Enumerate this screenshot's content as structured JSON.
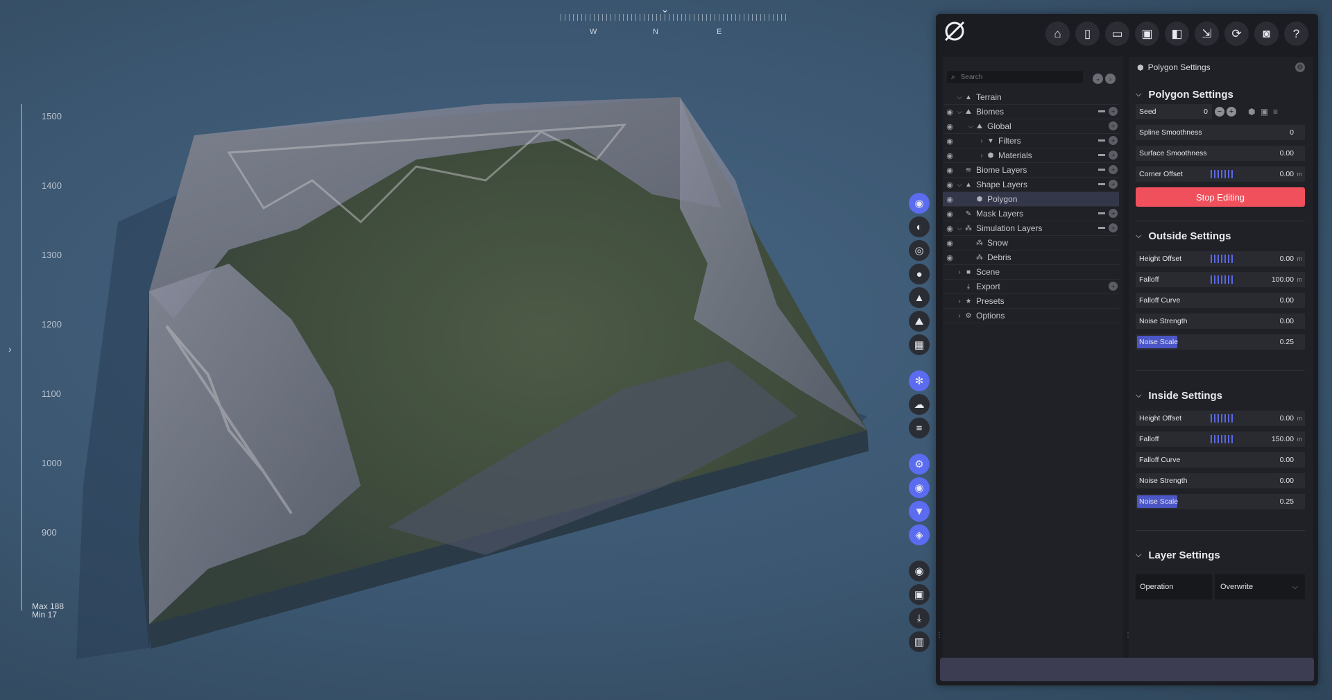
{
  "ruler": {
    "ticks": [
      "1500",
      "1400",
      "1300",
      "1200",
      "1100",
      "1000",
      "900"
    ],
    "max_label": "Max 188",
    "min_label": "Min 17"
  },
  "compass": {
    "w": "W",
    "n": "N",
    "e": "E"
  },
  "toolstrip": {
    "group1": [
      "terrain-tool-icon",
      "globe-icon",
      "target-icon",
      "water-drop-icon",
      "mountain-icon",
      "height-icon",
      "grid-icon"
    ],
    "group2": [
      "snow-icon",
      "cloud-icon",
      "layers-lines-icon"
    ],
    "group3": [
      "shuffle-icon",
      "eye-icon",
      "filter-icon",
      "stack-icon"
    ],
    "group4": [
      "record-icon",
      "image-icon",
      "download-icon",
      "chart-icon"
    ]
  },
  "topbar": {
    "icons": [
      "home-icon",
      "new-file-icon",
      "open-folder-icon",
      "save-icon",
      "save-as-icon",
      "export-icon",
      "refresh-icon",
      "camera-icon",
      "help-icon"
    ]
  },
  "tree": {
    "search_placeholder": "Search",
    "rows": [
      {
        "label": "Terrain",
        "indent": 0,
        "eye": false,
        "chev": "⌵",
        "icon": "▲",
        "btns": 0,
        "sel": false
      },
      {
        "label": "Biomes",
        "indent": 0,
        "eye": true,
        "chev": "⌵",
        "icon": "⛰",
        "btns": 2,
        "sel": false
      },
      {
        "label": "Global",
        "indent": 1,
        "eye": true,
        "chev": "⌵",
        "icon": "⛰",
        "btns": 1,
        "sel": false
      },
      {
        "label": "Filters",
        "indent": 2,
        "eye": true,
        "chev": "›",
        "icon": "▼",
        "btns": 2,
        "sel": false
      },
      {
        "label": "Materials",
        "indent": 2,
        "eye": true,
        "chev": "›",
        "icon": "⬢",
        "btns": 2,
        "sel": false
      },
      {
        "label": "Biome Layers",
        "indent": 0,
        "eye": true,
        "chev": "",
        "icon": "≋",
        "btns": 2,
        "sel": false
      },
      {
        "label": "Shape Layers",
        "indent": 0,
        "eye": true,
        "chev": "⌵",
        "icon": "▲",
        "btns": 2,
        "sel": false
      },
      {
        "label": "Polygon",
        "indent": 1,
        "eye": true,
        "chev": "",
        "icon": "⬢",
        "btns": 0,
        "sel": true
      },
      {
        "label": "Mask Layers",
        "indent": 0,
        "eye": true,
        "chev": "",
        "icon": "✎",
        "btns": 2,
        "sel": false
      },
      {
        "label": "Simulation Layers",
        "indent": 0,
        "eye": true,
        "chev": "⌵",
        "icon": "⁂",
        "btns": 2,
        "sel": false
      },
      {
        "label": "Snow",
        "indent": 1,
        "eye": true,
        "chev": "",
        "icon": "⁂",
        "btns": 0,
        "sel": false
      },
      {
        "label": "Debris",
        "indent": 1,
        "eye": true,
        "chev": "",
        "icon": "⁂",
        "btns": 0,
        "sel": false
      },
      {
        "label": "Scene",
        "indent": 0,
        "eye": false,
        "chev": "›",
        "icon": "■",
        "btns": 0,
        "sel": false
      },
      {
        "label": "Export",
        "indent": 0,
        "eye": false,
        "chev": "",
        "icon": "⤓",
        "btns": 1,
        "sel": false
      },
      {
        "label": "Presets",
        "indent": 0,
        "eye": false,
        "chev": "›",
        "icon": "★",
        "btns": 0,
        "sel": false
      },
      {
        "label": "Options",
        "indent": 0,
        "eye": false,
        "chev": "›",
        "icon": "⚙",
        "btns": 0,
        "sel": false
      }
    ]
  },
  "settings": {
    "header": "Polygon Settings",
    "polygon": {
      "title": "Polygon Settings",
      "seed_label": "Seed",
      "seed_value": "0",
      "spline_label": "Spline Smoothness",
      "spline_value": "0",
      "surface_label": "Surface Smoothness",
      "surface_value": "0.00",
      "corner_label": "Corner Offset",
      "corner_value": "0.00",
      "corner_unit": "m",
      "stop_label": "Stop Editing"
    },
    "outside": {
      "title": "Outside Settings",
      "height_label": "Height Offset",
      "height_value": "0.00",
      "height_unit": "m",
      "falloff_label": "Falloff",
      "falloff_value": "100.00",
      "falloff_unit": "m",
      "curve_label": "Falloff Curve",
      "curve_value": "0.00",
      "nstrength_label": "Noise Strength",
      "nstrength_value": "0.00",
      "nscale_label": "Noise Scale",
      "nscale_value": "0.25"
    },
    "inside": {
      "title": "Inside Settings",
      "height_label": "Height Offset",
      "height_value": "0.00",
      "height_unit": "m",
      "falloff_label": "Falloff",
      "falloff_value": "150.00",
      "falloff_unit": "m",
      "curve_label": "Falloff Curve",
      "curve_value": "0.00",
      "nstrength_label": "Noise Strength",
      "nstrength_value": "0.00",
      "nscale_label": "Noise Scale",
      "nscale_value": "0.25"
    },
    "layer": {
      "title": "Layer Settings",
      "operation_label": "Operation",
      "operation_value": "Overwrite"
    }
  },
  "colors": {
    "accent": "#5b6cf0",
    "danger": "#f0505c",
    "panel": "#1b1c21"
  }
}
